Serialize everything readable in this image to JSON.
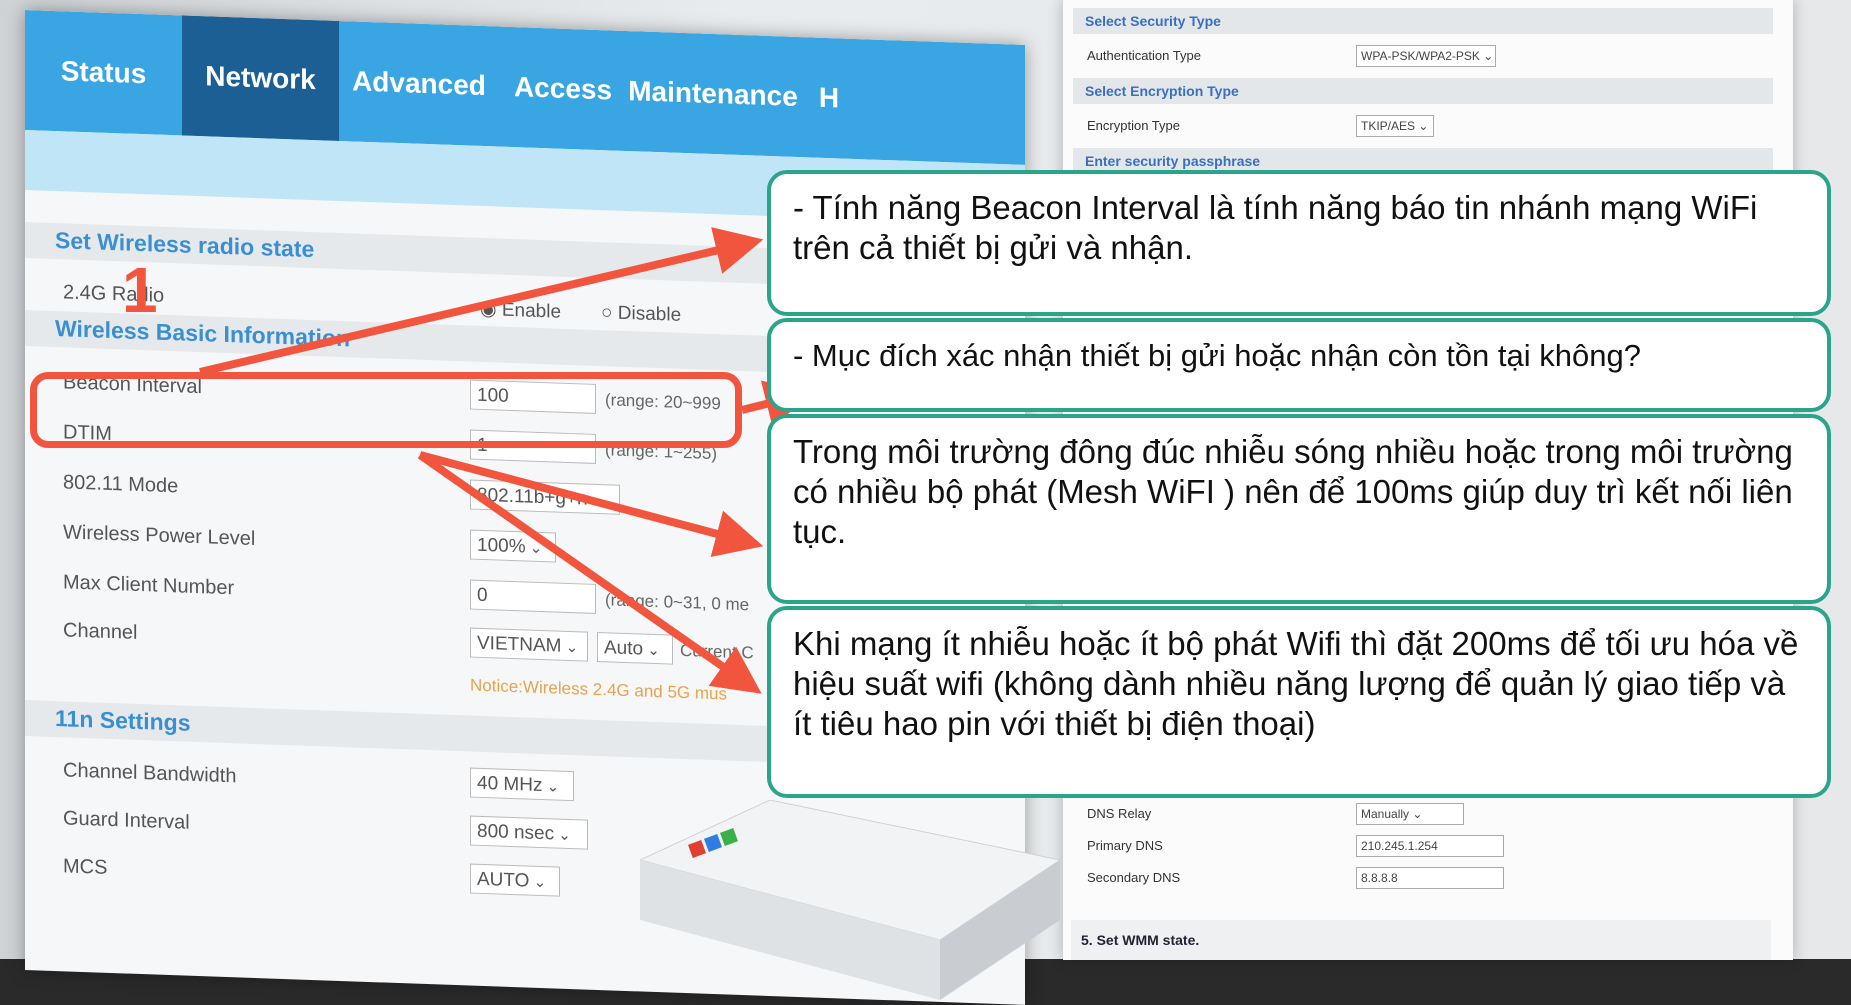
{
  "nav": {
    "tabs": [
      {
        "label": "Status"
      },
      {
        "label": "Network",
        "active": true
      },
      {
        "label": "Advanced"
      },
      {
        "label": "Access"
      },
      {
        "label": "Maintenance"
      },
      {
        "label": "H"
      }
    ]
  },
  "radio_state": {
    "heading": "Set Wireless radio state",
    "row_label": "2.4G Radio",
    "enable": "Enable",
    "disable": "Disable",
    "selected": "Enable"
  },
  "basic_info": {
    "heading": "Wireless Basic Information",
    "rows": [
      {
        "label": "Beacon Interval",
        "value": "100",
        "hint": "(range: 20~999"
      },
      {
        "label": "DTIM",
        "value": "1",
        "hint": "(range: 1~255)"
      },
      {
        "label": "802.11 Mode",
        "value": "802.11b+g+n"
      },
      {
        "label": "Wireless Power Level",
        "value": "100%"
      },
      {
        "label": "Max Client Number",
        "value": "0",
        "hint": "(range: 0~31, 0 me"
      },
      {
        "label": "Channel",
        "value": "VIETNAM",
        "value2": "Auto",
        "hint": "Current C"
      }
    ],
    "notice": "Notice:Wireless 2.4G and 5G mus"
  },
  "n_settings": {
    "heading": "11n Settings",
    "rows": [
      {
        "label": "Channel Bandwidth",
        "value": "40 MHz"
      },
      {
        "label": "Guard Interval",
        "value": "800 nsec"
      },
      {
        "label": "MCS",
        "value": "AUTO"
      }
    ]
  },
  "annotation_number": "1",
  "security": {
    "security_type_heading": "Select Security Type",
    "auth_label": "Authentication Type",
    "auth_value": "WPA-PSK/WPA2-PSK",
    "encryption_type_heading": "Select Encryption Type",
    "enc_label": "Encryption Type",
    "enc_value": "TKIP/AES",
    "passphrase_heading": "Enter security passphrase"
  },
  "dns": {
    "relay_label": "DNS Relay",
    "relay_value": "Manually",
    "primary_label": "Primary DNS",
    "primary_value": "210.245.1.254",
    "secondary_label": "Secondary DNS",
    "secondary_value": "8.8.8.8"
  },
  "wmm": {
    "heading": "5. Set WMM state."
  },
  "callouts": [
    "- Tính năng Beacon Interval là tính năng báo tin nhánh mạng WiFi trên cả thiết bị gửi và nhận.",
    "- Mục đích xác nhận thiết bị gửi hoặc nhận còn tồn tại không?",
    "Trong môi trường đông đúc nhiễu sóng nhiều hoặc trong môi trường có nhiều bộ phát (Mesh WiFI ) nên để 100ms giúp duy trì kết nối liên tục.",
    "Khi mạng ít nhiễu hoặc ít bộ phát Wifi thì đặt 200ms để tối ưu hóa về hiệu suất wifi (không dành nhiều năng lượng để quản lý giao tiếp và ít tiêu hao pin với thiết bị điện thoại)"
  ],
  "colors": {
    "nav_blue": "#39a6e3",
    "nav_active": "#1b5f95",
    "heading_blue": "#3a8fd0",
    "callout_border": "#2aa58a",
    "annotation_red": "#f2553d"
  }
}
